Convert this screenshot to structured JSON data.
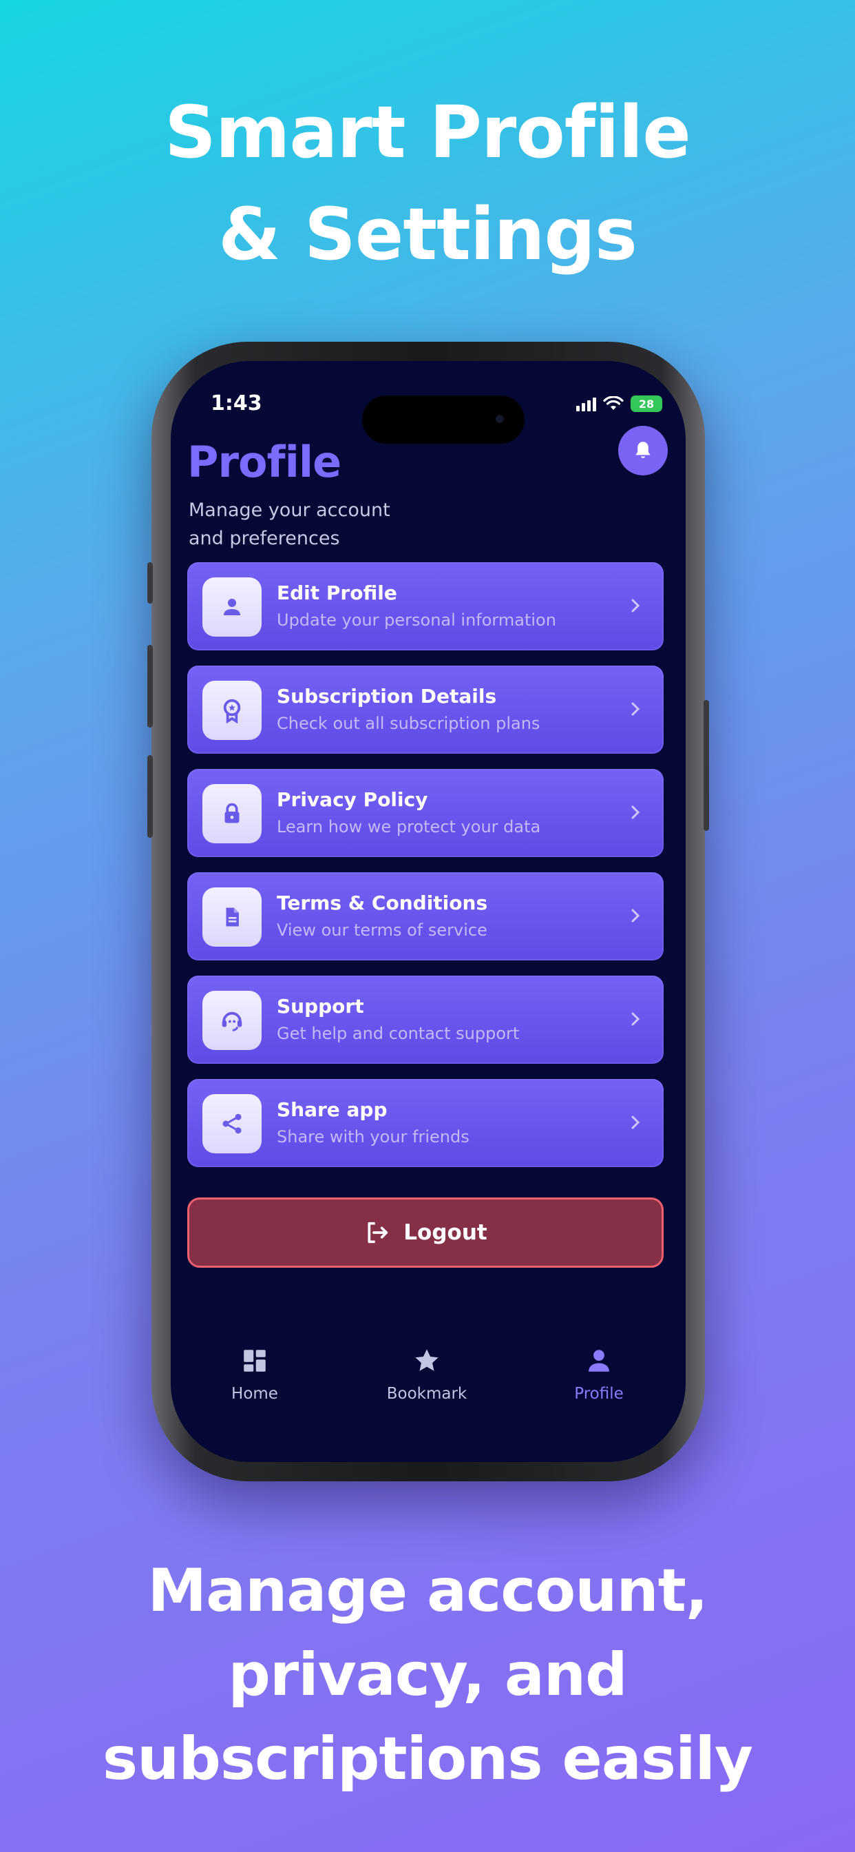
{
  "promo": {
    "headline": [
      "Smart Profile",
      "& Settings"
    ],
    "tagline": [
      "Manage account,",
      "privacy, and",
      "subscriptions easily"
    ]
  },
  "status_bar": {
    "time": "1:43",
    "battery": "28"
  },
  "header": {
    "title": "Profile",
    "subtitle": "Manage your account and preferences",
    "notification_icon": "bell-icon"
  },
  "menu": [
    {
      "title": "Edit Profile",
      "subtitle": "Update your personal information",
      "icon": "person-icon"
    },
    {
      "title": "Subscription Details",
      "subtitle": "Check out all subscription plans",
      "icon": "badge-icon"
    },
    {
      "title": "Privacy Policy",
      "subtitle": "Learn how we protect your data",
      "icon": "lock-icon"
    },
    {
      "title": "Terms & Conditions",
      "subtitle": "View our terms of service",
      "icon": "document-icon"
    },
    {
      "title": "Support",
      "subtitle": "Get help and contact support",
      "icon": "support-agent-icon"
    },
    {
      "title": "Share app",
      "subtitle": "Share with your friends",
      "icon": "share-icon"
    }
  ],
  "logout": {
    "label": "Logout",
    "icon": "logout-icon"
  },
  "tabs": [
    {
      "label": "Home",
      "icon": "dashboard-icon",
      "active": false
    },
    {
      "label": "Bookmark",
      "icon": "star-icon",
      "active": false
    },
    {
      "label": "Profile",
      "icon": "person-icon",
      "active": true
    }
  ],
  "colors": {
    "screen_bg": "#050734",
    "accent": "#7b6cff",
    "card": "#6a56ee",
    "logout_bg": "#853047",
    "logout_border": "#ef5f6e"
  }
}
